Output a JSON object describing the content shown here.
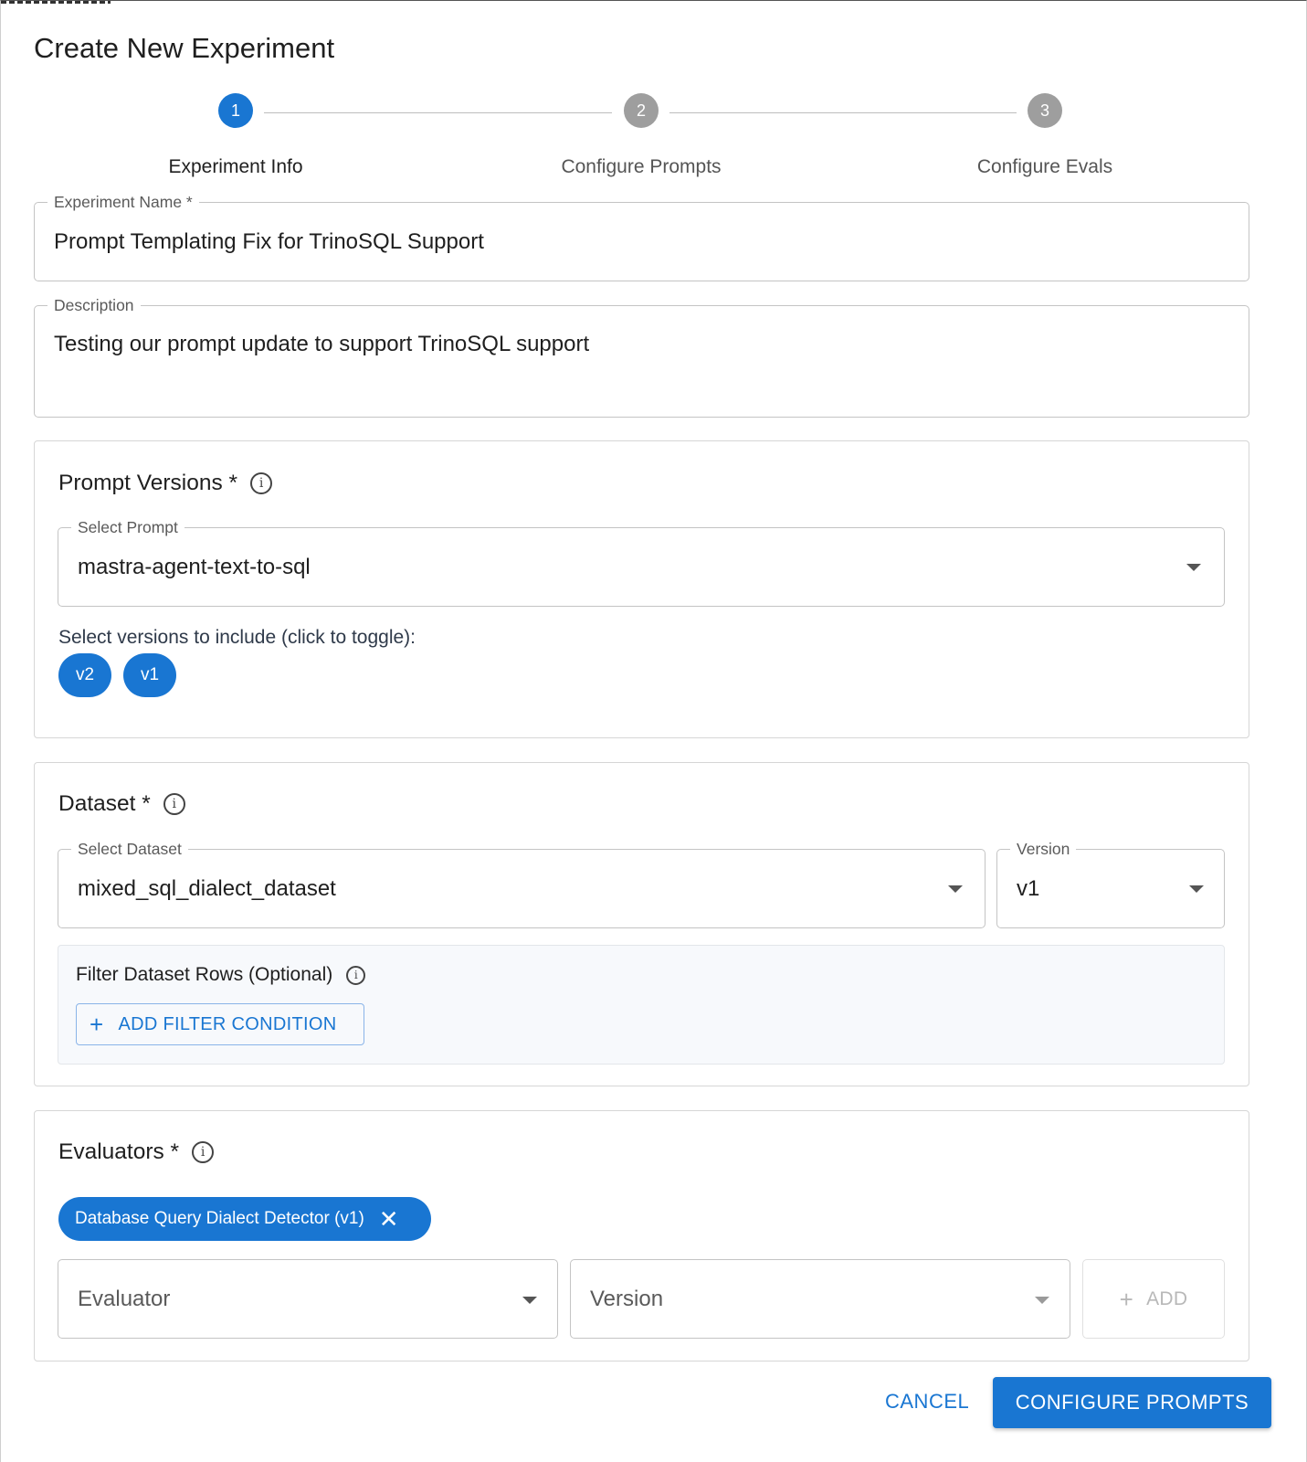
{
  "dialog": {
    "title": "Create New Experiment"
  },
  "stepper": {
    "steps": [
      {
        "number": "1",
        "label": "Experiment Info",
        "state": "active"
      },
      {
        "number": "2",
        "label": "Configure Prompts",
        "state": "inactive"
      },
      {
        "number": "3",
        "label": "Configure Evals",
        "state": "inactive"
      }
    ]
  },
  "experiment_name": {
    "label": "Experiment Name *",
    "value": "Prompt Templating Fix for TrinoSQL Support"
  },
  "description": {
    "label": "Description",
    "value": "Testing our prompt update to support TrinoSQL support"
  },
  "prompt_versions": {
    "title": "Prompt Versions *",
    "select_label": "Select Prompt",
    "selected_prompt": "mastra-agent-text-to-sql",
    "helper": "Select versions to include (click to toggle):",
    "versions": [
      "v2",
      "v1"
    ]
  },
  "dataset": {
    "title": "Dataset *",
    "select_label": "Select Dataset",
    "selected_dataset": "mixed_sql_dialect_dataset",
    "version_label": "Version",
    "version_value": "v1",
    "filter_title": "Filter Dataset Rows (Optional)",
    "add_filter_label": "ADD FILTER CONDITION"
  },
  "evaluators": {
    "title": "Evaluators *",
    "selected_chip": "Database Query Dialect Detector (v1)",
    "evaluator_placeholder": "Evaluator",
    "version_placeholder": "Version",
    "add_label": "ADD"
  },
  "actions": {
    "cancel": "CANCEL",
    "next": "CONFIGURE PROMPTS"
  },
  "colors": {
    "primary": "#1976d2",
    "inactive_step": "#9e9e9e",
    "border": "#c4c4c4"
  },
  "icons": [
    "info-icon",
    "dropdown-caret-icon",
    "plus-icon",
    "close-icon"
  ]
}
